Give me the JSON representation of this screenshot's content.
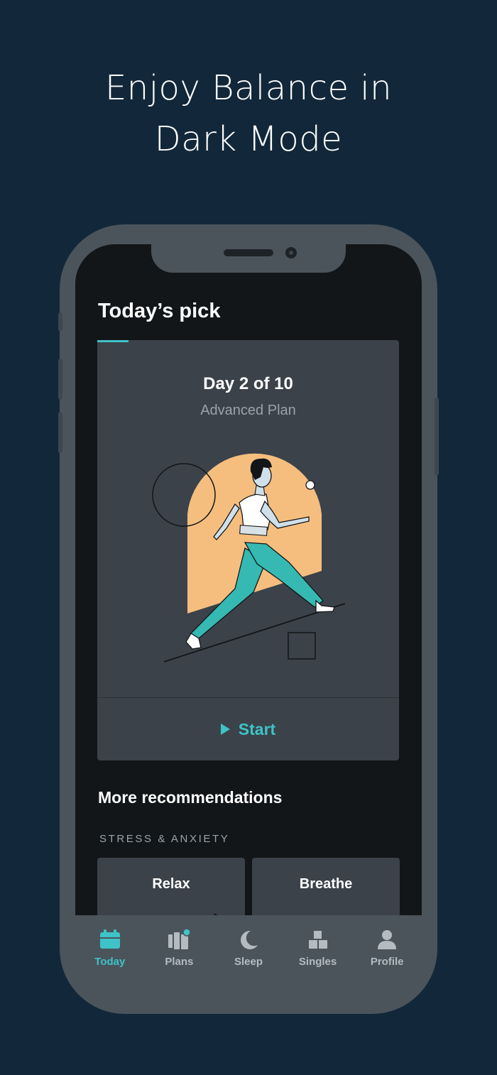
{
  "headline": {
    "line1": "Enjoy Balance in",
    "line2": "Dark Mode"
  },
  "colors": {
    "background": "#12283a",
    "accent": "#3ec3c8",
    "illustration_arch": "#f6be7e",
    "card": "#3b4249",
    "screen": "#121619"
  },
  "todays_pick": {
    "title": "Today’s pick",
    "day": "Day 2 of 10",
    "plan": "Advanced Plan",
    "start_label": "Start"
  },
  "recommendations": {
    "title": "More recommendations",
    "category": "STRESS & ANXIETY",
    "cards": [
      {
        "label": "Relax"
      },
      {
        "label": "Breathe"
      }
    ]
  },
  "tabs": [
    {
      "label": "Today",
      "icon": "calendar-icon",
      "active": true
    },
    {
      "label": "Plans",
      "icon": "plans-icon",
      "active": false,
      "badge": true
    },
    {
      "label": "Sleep",
      "icon": "moon-icon",
      "active": false
    },
    {
      "label": "Singles",
      "icon": "blocks-icon",
      "active": false
    },
    {
      "label": "Profile",
      "icon": "person-icon",
      "active": false
    }
  ]
}
